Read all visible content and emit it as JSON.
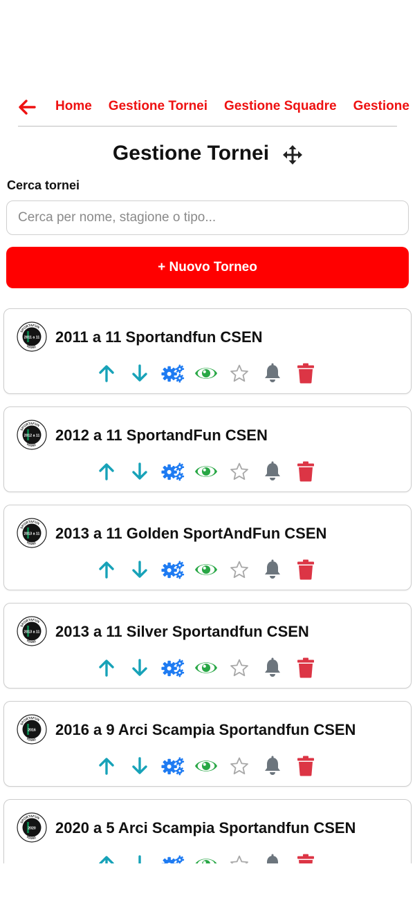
{
  "nav": {
    "back_icon": "arrow-left-icon",
    "links": [
      "Home",
      "Gestione Tornei",
      "Gestione Squadre",
      "Gestione"
    ]
  },
  "header": {
    "title": "Gestione Tornei",
    "move_icon": "move-arrows-icon"
  },
  "search": {
    "label": "Cerca tornei",
    "placeholder": "Cerca per nome, stagione o tipo...",
    "value": ""
  },
  "new_button": {
    "label": "+ Nuovo Torneo"
  },
  "colors": {
    "accent": "#ff0000",
    "nav_link": "#ee1111",
    "arrow": "#17a2b8",
    "gears": "#1e7bf2",
    "eye": "#28a745",
    "star": "#a8a8a8",
    "bell": "#6c757d",
    "trash": "#dc3545"
  },
  "action_icons": [
    "arrow-up-icon",
    "arrow-down-icon",
    "gears-icon",
    "eye-icon",
    "star-icon",
    "bell-icon",
    "trash-icon"
  ],
  "tournaments": [
    {
      "name": "2011 a 11 Sportandfun CSEN",
      "logo_text": "2011 a 11"
    },
    {
      "name": "2012 a 11 SportandFun CSEN",
      "logo_text": "2012 a 11"
    },
    {
      "name": "2013 a 11 Golden SportAndFun CSEN",
      "logo_text": "2013 a 11"
    },
    {
      "name": "2013 a 11 Silver Sportandfun CSEN",
      "logo_text": "2013 a 11"
    },
    {
      "name": "2016 a 9 Arci Scampia Sportandfun CSEN",
      "logo_text": "2016"
    },
    {
      "name": "2020 a 5 Arci Scampia Sportandfun CSEN",
      "logo_text": "2020"
    }
  ]
}
